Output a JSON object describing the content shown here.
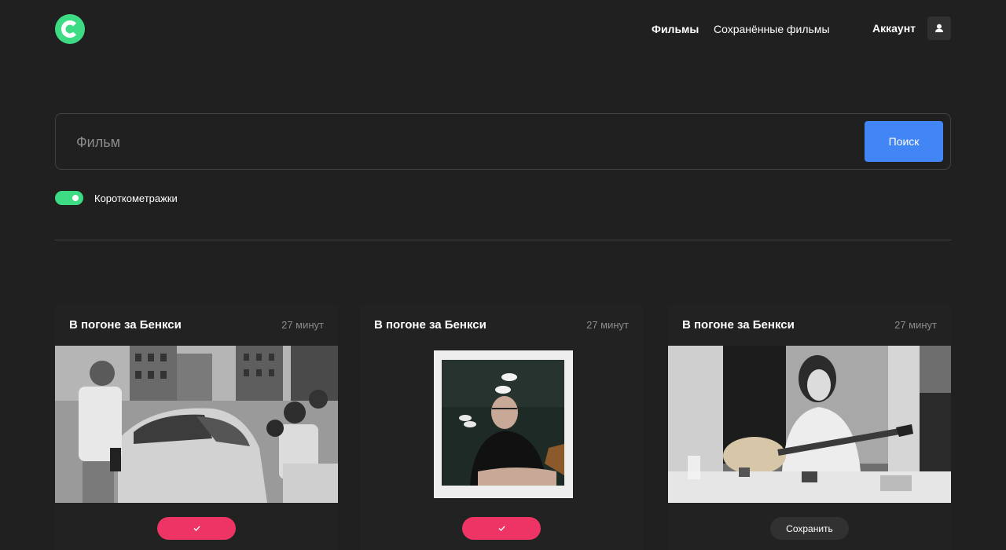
{
  "header": {
    "logo_icon": "logo-c-icon",
    "nav": {
      "movies": "Фильмы",
      "saved_movies": "Сохранённые фильмы"
    },
    "account_label": "Аккаунт",
    "account_icon": "user-icon"
  },
  "search": {
    "placeholder": "Фильм",
    "value": "",
    "button_label": "Поиск"
  },
  "filter": {
    "shorts_label": "Короткометражки",
    "shorts_enabled": true
  },
  "colors": {
    "background": "#202020",
    "accent_green": "#3ddc84",
    "search_blue": "#4285f4",
    "saved_pink": "#ee3465"
  },
  "cards": [
    {
      "title": "В погоне за Бенкси",
      "duration": "27 минут",
      "saved": true,
      "button_icon": "check-icon"
    },
    {
      "title": "В погоне за Бенкси",
      "duration": "27 минут",
      "saved": true,
      "button_icon": "check-icon"
    },
    {
      "title": "В погоне за Бенкси",
      "duration": "27 минут",
      "saved": false,
      "button_label": "Сохранить"
    }
  ]
}
